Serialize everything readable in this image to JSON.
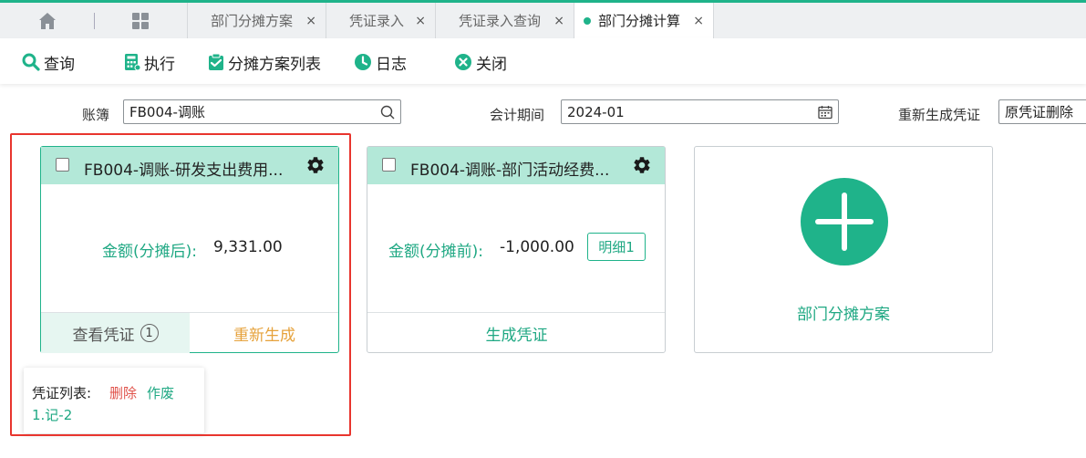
{
  "tabs": [
    {
      "label": "部门分摊方案",
      "close": "×"
    },
    {
      "label": "凭证录入",
      "close": "×"
    },
    {
      "label": "凭证录入查询",
      "close": "×"
    },
    {
      "label": "部门分摊计算",
      "close": "×",
      "active": true
    }
  ],
  "toolbar": {
    "query": "查询",
    "execute": "执行",
    "plan_list": "分摊方案列表",
    "log": "日志",
    "close": "关闭"
  },
  "filters": {
    "ledger_label": "账簿",
    "ledger_value": "FB004-调账",
    "period_label": "会计期间",
    "period_value": "2024-01",
    "regen_label": "重新生成凭证",
    "regen_value": "原凭证删除"
  },
  "cards": [
    {
      "title": "FB004-调账-研发支出费用...",
      "amount_label": "金额(分摊后):",
      "amount_value": "9,331.00",
      "view_voucher": "查看凭证",
      "voucher_count": "1",
      "regenerate": "重新生成"
    },
    {
      "title": "FB004-调账-部门活动经费...",
      "amount_label": "金额(分摊前):",
      "amount_value": "-1,000.00",
      "detail": "明细1",
      "generate": "生成凭证"
    }
  ],
  "add_card": {
    "label": "部门分摊方案"
  },
  "popover": {
    "title": "凭证列表:",
    "delete": "删除",
    "void": "作废",
    "item": "1.记-2"
  },
  "colors": {
    "accent": "#1fb38a",
    "header_bg": "#b3e8d8",
    "highlight": "#e8352e",
    "orange": "#e6a23c"
  }
}
